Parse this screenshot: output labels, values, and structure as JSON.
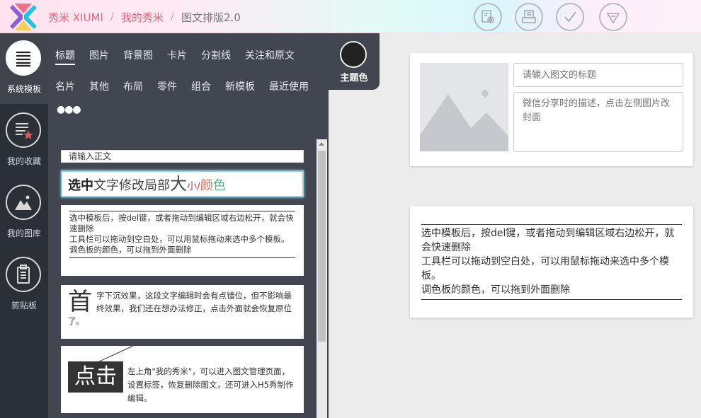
{
  "header": {
    "brand": "秀米 XIUMI",
    "breadcrumb_my": "我的秀米",
    "breadcrumb_current": "图文排版2.0",
    "separator": "/",
    "toolbar_icons": [
      "preview-icon",
      "save-icon",
      "check-icon",
      "download-icon"
    ]
  },
  "sidebar": {
    "items": [
      {
        "label": "系统模板",
        "icon": "menu-lines-icon"
      },
      {
        "label": "我的收藏",
        "icon": "favorite-list-icon"
      },
      {
        "label": "我的图库",
        "icon": "image-gallery-icon"
      },
      {
        "label": "剪贴板",
        "icon": "clipboard-icon"
      }
    ]
  },
  "categories": {
    "row1": [
      "标题",
      "图片",
      "背景图",
      "卡片",
      "分割线",
      "关注和原文"
    ],
    "row2": [
      "名片",
      "其他",
      "布局",
      "零件",
      "组合",
      "新模板",
      "最近使用"
    ],
    "more": "●●●"
  },
  "theme": {
    "label": "主题色",
    "color": "#222222"
  },
  "templates": {
    "t1": "请输入正文",
    "t2": {
      "bold": "选中",
      "a": "文字修改局部",
      "big": "大",
      "small": "小",
      "slash": "/",
      "c1": "颜",
      "c2": "色"
    },
    "t3": [
      "选中模板后，按del键，或者拖动到编辑区域右边松开，就会快速删除",
      "工具栏可以拖动到空白处，可以用鼠标拖动来选中多个模板。",
      "调色板的颜色，可以拖到外面删除"
    ],
    "t4": {
      "drop": "首",
      "text": "字下沉效果，这段文字编辑时会有点错位，但不影响最终效果，我们还在想办法修正，点击外面就会恢复原位了。"
    },
    "t5": {
      "click": "点击",
      "text": "左上角\"我的秀米\"，可以进入图文管理页面，设置标签，恢复删除图文，还可进入H5秀制作编辑。"
    }
  },
  "editor": {
    "title_placeholder": "请输入图文的标题",
    "desc_placeholder": "微信分享时的描述，点击左侧图片改封面",
    "content": [
      "选中模板后，按del键，或者拖动到编辑区域右边松开，就会快速删除",
      "工具栏可以拖动到空白处，可以用鼠标拖动来选中多个模板。",
      "调色板的颜色，可以拖到外面删除"
    ]
  }
}
